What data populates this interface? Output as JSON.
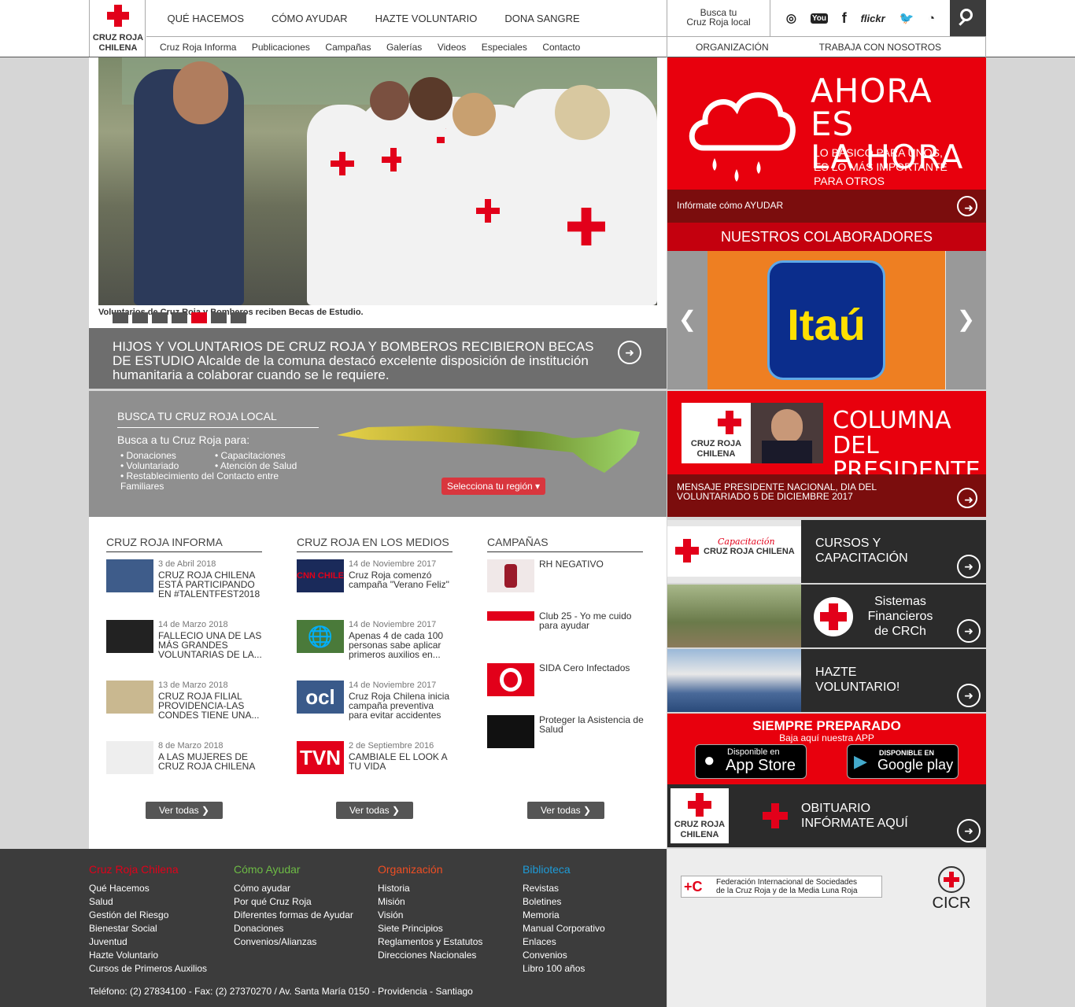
{
  "header": {
    "logo_line1": "CRUZ ROJA",
    "logo_line2": "CHILENA",
    "main_nav": [
      "QUÉ HACEMOS",
      "CÓMO AYUDAR",
      "HAZTE VOLUNTARIO",
      "DONA SANGRE"
    ],
    "sub_nav": [
      "Cruz Roja Informa",
      "Publicaciones",
      "Campañas",
      "Galerías",
      "Videos",
      "Especiales",
      "Contacto"
    ],
    "busca_line1": "Busca tu",
    "busca_line2": "Cruz Roja local",
    "social": [
      "instagram-icon",
      "youtube-icon",
      "facebook-icon",
      "flickr-icon",
      "twitter-icon",
      "rss-icon"
    ],
    "social_labels": [
      "◎",
      "You",
      "f",
      "flickr",
      "🐦",
      "◔"
    ],
    "org_nav": [
      "ORGANIZACIÓN",
      "TRABAJA CON NOSOTROS"
    ]
  },
  "hero": {
    "caption": "Voluntarios de Cruz Roja y Bomberos reciben Becas de Estudio.",
    "active_slide": 5,
    "slide_count": 7,
    "headline": "HIJOS Y VOLUNTARIOS DE CRUZ ROJA Y BOMBEROS RECIBIERON BECAS DE ESTUDIO Alcalde de la comuna destacó excelente disposición de institución humanitaria a colaborar cuando se le requiere."
  },
  "local": {
    "title": "BUSCA TU CRUZ ROJA LOCAL",
    "subtitle": "Busca a tu Cruz Roja para:",
    "col1": [
      "Donaciones",
      "Voluntariado",
      "Restablecimiento del Contacto entre Familiares"
    ],
    "col2": [
      "Capacitaciones",
      "Atención de Salud"
    ],
    "select_label": "Selecciona tu región ▾"
  },
  "news": {
    "informa": {
      "title": "CRUZ ROJA INFORMA",
      "items": [
        {
          "date": "3 de Abril 2018",
          "title": "CRUZ ROJA CHILENA ESTÁ PARTICIPANDO EN #TALENTFEST2018"
        },
        {
          "date": "14 de Marzo 2018",
          "title": "FALLECIO UNA DE LAS MÁS GRANDES VOLUNTARIAS DE LA..."
        },
        {
          "date": "13 de Marzo 2018",
          "title": "CRUZ ROJA FILIAL PROVIDENCIA-LAS CONDES TIENE UNA..."
        },
        {
          "date": "8 de Marzo 2018",
          "title": "A LAS MUJERES DE CRUZ ROJA CHILENA"
        }
      ]
    },
    "medios": {
      "title": "CRUZ ROJA EN LOS MEDIOS",
      "items": [
        {
          "date": "14 de Noviembre 2017",
          "title": "Cruz Roja comenzó campaña \"Verano Feliz\"",
          "thumb": "CNN CHILE"
        },
        {
          "date": "14 de Noviembre 2017",
          "title": "Apenas 4 de cada 100 personas sabe aplicar primeros auxilios en...",
          "thumb": "🌐"
        },
        {
          "date": "14 de Noviembre 2017",
          "title": "Cruz Roja Chilena inicia campaña preventiva para evitar accidentes",
          "thumb": "ocl"
        },
        {
          "date": "2 de Septiembre 2016",
          "title": "CAMBIALE EL LOOK A TU VIDA",
          "thumb": "TVN"
        }
      ]
    },
    "campanas": {
      "title": "CAMPAÑAS",
      "items": [
        {
          "title": "RH NEGATIVO"
        },
        {
          "title": "Club 25 - Yo me cuido para ayudar"
        },
        {
          "title": "SIDA Cero Infectados"
        },
        {
          "title": "Proteger la Asistencia de Salud"
        }
      ]
    },
    "ver_todas": "Ver todas ❯"
  },
  "sidebar": {
    "ahora_big1": "AHORA ES",
    "ahora_big2": "LA HORA",
    "ahora_small": [
      "LO BÁSICO PARA UNOS,",
      "ES LO MÁS IMPORTANTE",
      "PARA OTROS"
    ],
    "ahora_link": "Infórmate cómo AYUDAR",
    "colab_title": "NUESTROS COLABORADORES",
    "colab_logo": "Itaú",
    "pres_card1": "CRUZ ROJA",
    "pres_card2": "CHILENA",
    "pres_big1": "COLUMNA DEL",
    "pres_big2": "PRESIDENTE",
    "pres_text": "MENSAJE PRESIDENTE NACIONAL, DIA DEL VOLUNTARIADO 5 DE DICIEMBRE 2017",
    "cursos_brand1": "Capacitación",
    "cursos_brand2": "CRUZ ROJA CHILENA",
    "cursos": "CURSOS Y CAPACITACIÓN",
    "sistemas": "Sistemas Financieros de CRCh",
    "hazte": "HAZTE VOLUNTARIO!",
    "siempre_title": "SIEMPRE PREPARADO",
    "siempre_sub": "Baja aquí nuestra APP",
    "appstore_small": "Disponible en",
    "appstore_big": "App Store",
    "gplay_small": "DISPONIBLE EN",
    "gplay_big": "Google play",
    "obit_card1": "CRUZ ROJA",
    "obit_card2": "CHILENA",
    "obituario1": "OBITUARIO",
    "obituario2": "INFÓRMATE AQUÍ"
  },
  "footer": {
    "cols": [
      {
        "title": "Cruz Roja Chilena",
        "color": "#e2001a",
        "links": [
          "Qué Hacemos",
          "Salud",
          "Gestión del Riesgo",
          "Bienestar Social",
          "Juventud",
          "Hazte Voluntario",
          "Cursos de Primeros Auxilios"
        ]
      },
      {
        "title": "Cómo Ayudar",
        "color": "#6dbb45",
        "links": [
          "Cómo ayudar",
          "Por qué Cruz Roja",
          "Diferentes formas de Ayudar",
          "Donaciones",
          "Convenios/Alianzas"
        ]
      },
      {
        "title": "Organización",
        "color": "#f04e23",
        "links": [
          "Historia",
          "Misión",
          "Visión",
          "Siete Principios",
          "Reglamentos y Estatutos",
          "Direcciones Nacionales"
        ]
      },
      {
        "title": "Biblioteca",
        "color": "#1e9bd7",
        "links": [
          "Revistas",
          "Boletines",
          "Memoria",
          "Manual Corporativo",
          "Enlaces",
          "Convenios",
          "Libro 100 años"
        ]
      }
    ],
    "address": "Teléfono: (2) 27834100 - Fax: (2) 27370270 / Av. Santa María 0150 - Providencia - Santiago",
    "ifrc1": "Federación Internacional de Sociedades",
    "ifrc2": "de la Cruz Roja y de la Media Luna Roja",
    "icrc": "CICR"
  }
}
